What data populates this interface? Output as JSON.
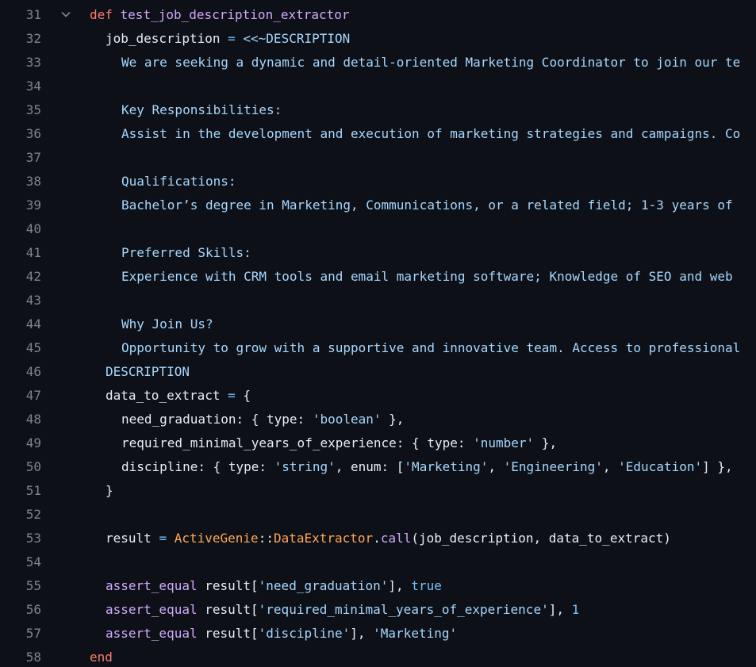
{
  "editor": {
    "lines": [
      {
        "n": "31",
        "indent": 0,
        "fold": true,
        "tokens": [
          {
            "t": "def",
            "c": "kw"
          },
          {
            "t": " test_job_description_extractor",
            "c": "fn"
          }
        ]
      },
      {
        "n": "32",
        "indent": 1,
        "tokens": [
          {
            "t": "job_description ",
            "c": "plain"
          },
          {
            "t": "=",
            "c": "op"
          },
          {
            "t": " <<~DESCRIPTION",
            "c": "str"
          }
        ]
      },
      {
        "n": "33",
        "indent": 2,
        "tokens": [
          {
            "t": "We are seeking a dynamic and detail-oriented Marketing Coordinator to join our te",
            "c": "str"
          }
        ]
      },
      {
        "n": "34",
        "indent": 0,
        "tokens": []
      },
      {
        "n": "35",
        "indent": 2,
        "tokens": [
          {
            "t": "Key Responsibilities:",
            "c": "str"
          }
        ]
      },
      {
        "n": "36",
        "indent": 2,
        "tokens": [
          {
            "t": "Assist in the development and execution of marketing strategies and campaigns. Co",
            "c": "str"
          }
        ]
      },
      {
        "n": "37",
        "indent": 0,
        "tokens": []
      },
      {
        "n": "38",
        "indent": 2,
        "tokens": [
          {
            "t": "Qualifications:",
            "c": "str"
          }
        ]
      },
      {
        "n": "39",
        "indent": 2,
        "tokens": [
          {
            "t": "Bachelor’s degree in Marketing, Communications, or a related field; 1-3 years of",
            "c": "str"
          }
        ]
      },
      {
        "n": "40",
        "indent": 0,
        "tokens": []
      },
      {
        "n": "41",
        "indent": 2,
        "tokens": [
          {
            "t": "Preferred Skills:",
            "c": "str"
          }
        ]
      },
      {
        "n": "42",
        "indent": 2,
        "tokens": [
          {
            "t": "Experience with CRM tools and email marketing software; Knowledge of SEO and web",
            "c": "str"
          }
        ]
      },
      {
        "n": "43",
        "indent": 0,
        "tokens": []
      },
      {
        "n": "44",
        "indent": 2,
        "tokens": [
          {
            "t": "Why Join Us?",
            "c": "str"
          }
        ]
      },
      {
        "n": "45",
        "indent": 2,
        "tokens": [
          {
            "t": "Opportunity to grow with a supportive and innovative team. Access to professional",
            "c": "str"
          }
        ]
      },
      {
        "n": "46",
        "indent": 1,
        "tokens": [
          {
            "t": "DESCRIPTION",
            "c": "str"
          }
        ]
      },
      {
        "n": "47",
        "indent": 1,
        "tokens": [
          {
            "t": "data_to_extract ",
            "c": "plain"
          },
          {
            "t": "=",
            "c": "op"
          },
          {
            "t": " {",
            "c": "plain"
          }
        ]
      },
      {
        "n": "48",
        "indent": 2,
        "tokens": [
          {
            "t": "need_graduation: { type: ",
            "c": "plain"
          },
          {
            "t": "'boolean'",
            "c": "str"
          },
          {
            "t": " },",
            "c": "plain"
          }
        ]
      },
      {
        "n": "49",
        "indent": 2,
        "tokens": [
          {
            "t": "required_minimal_years_of_experience: { type: ",
            "c": "plain"
          },
          {
            "t": "'number'",
            "c": "str"
          },
          {
            "t": " },",
            "c": "plain"
          }
        ]
      },
      {
        "n": "50",
        "indent": 2,
        "tokens": [
          {
            "t": "discipline: { type: ",
            "c": "plain"
          },
          {
            "t": "'string'",
            "c": "str"
          },
          {
            "t": ", enum: [",
            "c": "plain"
          },
          {
            "t": "'Marketing'",
            "c": "str"
          },
          {
            "t": ", ",
            "c": "plain"
          },
          {
            "t": "'Engineering'",
            "c": "str"
          },
          {
            "t": ", ",
            "c": "plain"
          },
          {
            "t": "'Education'",
            "c": "str"
          },
          {
            "t": "] },",
            "c": "plain"
          }
        ]
      },
      {
        "n": "51",
        "indent": 1,
        "tokens": [
          {
            "t": "}",
            "c": "plain"
          }
        ]
      },
      {
        "n": "52",
        "indent": 0,
        "tokens": []
      },
      {
        "n": "53",
        "indent": 1,
        "tokens": [
          {
            "t": "result ",
            "c": "plain"
          },
          {
            "t": "=",
            "c": "op"
          },
          {
            "t": " ",
            "c": "plain"
          },
          {
            "t": "ActiveGenie",
            "c": "cls"
          },
          {
            "t": "::",
            "c": "plain"
          },
          {
            "t": "DataExtractor",
            "c": "cls"
          },
          {
            "t": ".",
            "c": "plain"
          },
          {
            "t": "call",
            "c": "fn"
          },
          {
            "t": "(job_description, data_to_extract)",
            "c": "plain"
          }
        ]
      },
      {
        "n": "54",
        "indent": 0,
        "tokens": []
      },
      {
        "n": "55",
        "indent": 1,
        "tokens": [
          {
            "t": "assert_equal",
            "c": "fn"
          },
          {
            "t": " result[",
            "c": "plain"
          },
          {
            "t": "'need_graduation'",
            "c": "str"
          },
          {
            "t": "], ",
            "c": "plain"
          },
          {
            "t": "true",
            "c": "const"
          }
        ]
      },
      {
        "n": "56",
        "indent": 1,
        "tokens": [
          {
            "t": "assert_equal",
            "c": "fn"
          },
          {
            "t": " result[",
            "c": "plain"
          },
          {
            "t": "'required_minimal_years_of_experience'",
            "c": "str"
          },
          {
            "t": "], ",
            "c": "plain"
          },
          {
            "t": "1",
            "c": "const"
          }
        ]
      },
      {
        "n": "57",
        "indent": 1,
        "tokens": [
          {
            "t": "assert_equal",
            "c": "fn"
          },
          {
            "t": " result[",
            "c": "plain"
          },
          {
            "t": "'discipline'",
            "c": "str"
          },
          {
            "t": "], ",
            "c": "plain"
          },
          {
            "t": "'Marketing'",
            "c": "str"
          }
        ]
      },
      {
        "n": "58",
        "indent": 0,
        "tokens": [
          {
            "t": "end",
            "c": "kw"
          }
        ]
      }
    ]
  },
  "colors": {
    "background": "#0d1117",
    "line_number": "#7d8590",
    "keyword": "#ff7b72",
    "function": "#d2a8ff",
    "class": "#ffa657",
    "string": "#a5d6ff",
    "constant": "#79c0ff",
    "text": "#e6edf3"
  },
  "icons": {
    "fold": "chevron-down-icon"
  }
}
